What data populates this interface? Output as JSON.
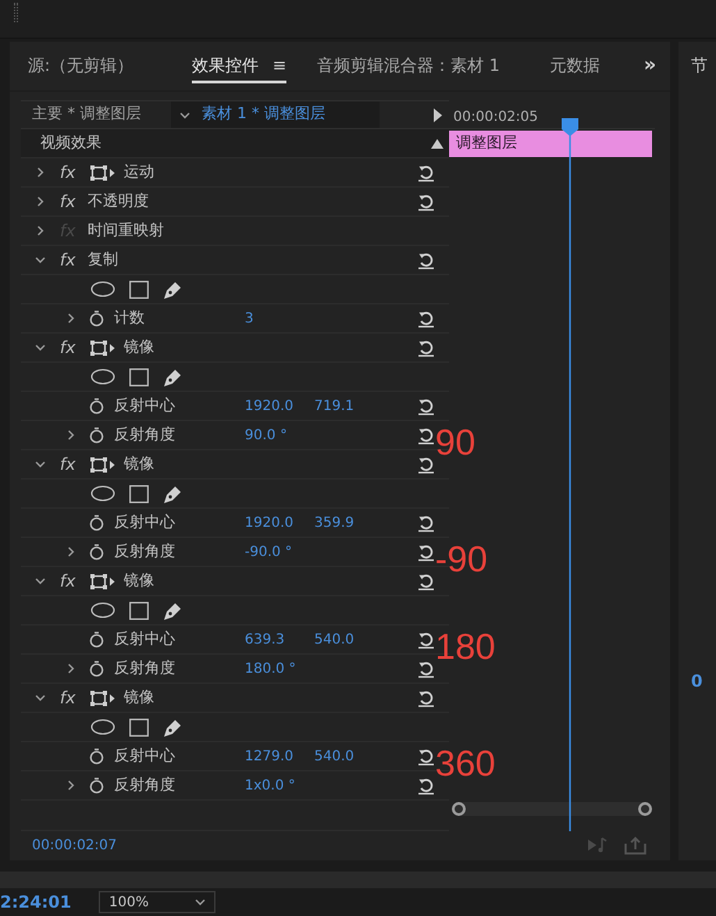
{
  "top_bar": {
    "right_panel_title": "节"
  },
  "tabs": [
    {
      "label": "源:（无剪辑）",
      "selected": false
    },
    {
      "label": "效果控件",
      "selected": true,
      "menu": "≡"
    },
    {
      "label": "音频剪辑混合器：素材 1",
      "selected": false
    },
    {
      "label": "元数据",
      "selected": false
    }
  ],
  "tabs_overflow": "»",
  "header": {
    "master": "主要 * 调整图层",
    "clip": "素材 1 * 调整图层",
    "timecode": "00:00:02:05"
  },
  "section": {
    "title": "视频效果",
    "clip_label": "调整图层"
  },
  "rows": [
    {
      "kind": "effect",
      "badge": "fx",
      "name": "运动",
      "expanded": false,
      "enabled": true,
      "transform_icon": true,
      "reset": true
    },
    {
      "kind": "effect",
      "badge": "fx",
      "name": "不透明度",
      "expanded": false,
      "enabled": true,
      "transform_icon": false,
      "reset": true
    },
    {
      "kind": "effect",
      "badge": "fx",
      "name": "时间重映射",
      "expanded": false,
      "enabled": false,
      "transform_icon": false,
      "reset": false
    },
    {
      "kind": "effect",
      "badge": "fx",
      "name": "复制",
      "expanded": true,
      "enabled": true,
      "transform_icon": false,
      "reset": true
    },
    {
      "kind": "masks"
    },
    {
      "kind": "param",
      "name": "计数",
      "expandable": true,
      "values": [
        "3"
      ]
    },
    {
      "kind": "effect",
      "badge": "fx",
      "name": "镜像",
      "expanded": true,
      "enabled": true,
      "transform_icon": true,
      "reset": true
    },
    {
      "kind": "masks"
    },
    {
      "kind": "param",
      "name": "反射中心",
      "expandable": false,
      "values": [
        "1920.0",
        "719.1"
      ]
    },
    {
      "kind": "param",
      "name": "反射角度",
      "expandable": true,
      "values": [
        "90.0 °"
      ],
      "annotation": "90"
    },
    {
      "kind": "effect",
      "badge": "fx",
      "name": "镜像",
      "expanded": true,
      "enabled": true,
      "transform_icon": true,
      "reset": true
    },
    {
      "kind": "masks"
    },
    {
      "kind": "param",
      "name": "反射中心",
      "expandable": false,
      "values": [
        "1920.0",
        "359.9"
      ]
    },
    {
      "kind": "param",
      "name": "反射角度",
      "expandable": true,
      "values": [
        "-90.0 °"
      ],
      "annotation": "-90"
    },
    {
      "kind": "effect",
      "badge": "fx",
      "name": "镜像",
      "expanded": true,
      "enabled": true,
      "transform_icon": true,
      "reset": true
    },
    {
      "kind": "masks"
    },
    {
      "kind": "param",
      "name": "反射中心",
      "expandable": false,
      "values": [
        "639.3",
        "540.0"
      ],
      "annotation": "180"
    },
    {
      "kind": "param",
      "name": "反射角度",
      "expandable": true,
      "values": [
        "180.0 °"
      ]
    },
    {
      "kind": "effect",
      "badge": "fx",
      "name": "镜像",
      "expanded": true,
      "enabled": true,
      "transform_icon": true,
      "reset": true
    },
    {
      "kind": "masks"
    },
    {
      "kind": "param",
      "name": "反射中心",
      "expandable": false,
      "values": [
        "1279.0",
        "540.0"
      ],
      "annotation": "360"
    },
    {
      "kind": "param",
      "name": "反射角度",
      "expandable": true,
      "values": [
        "1x0.0 °"
      ]
    }
  ],
  "footer": {
    "timecode": "00:00:02:07"
  },
  "right_panel": {
    "timecode_fragment": "0"
  },
  "bottom_bar": {
    "timecode": "2:24:01",
    "zoom": "100%"
  }
}
